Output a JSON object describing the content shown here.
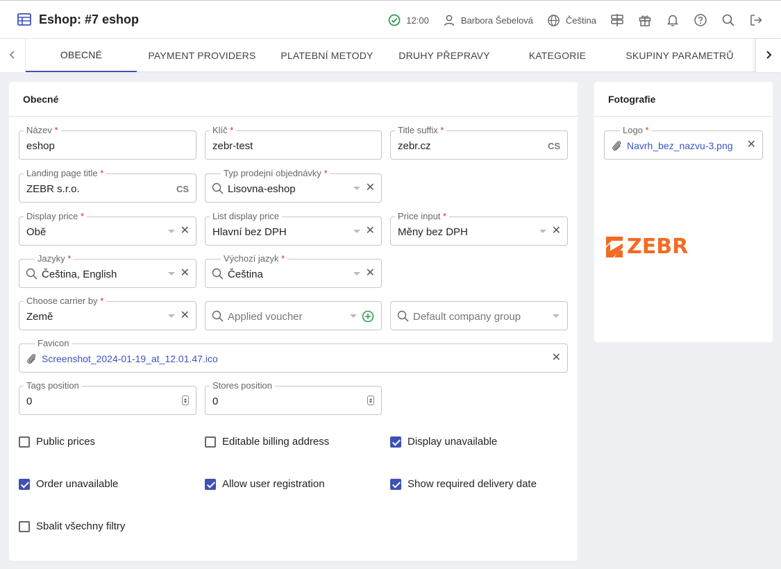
{
  "header": {
    "title": "Eshop: #7 eshop",
    "time": "12:00",
    "user": "Barbora Šebelová",
    "language": "Čeština"
  },
  "tabs": [
    {
      "label": "OBECNÉ",
      "active": true
    },
    {
      "label": "PAYMENT PROVIDERS"
    },
    {
      "label": "PLATEBNÍ METODY"
    },
    {
      "label": "DRUHY PŘEPRAVY"
    },
    {
      "label": "KATEGORIE"
    },
    {
      "label": "SKUPINY PARAMETRŮ"
    }
  ],
  "general": {
    "title": "Obecné",
    "fields": {
      "name": {
        "label": "Název",
        "value": "eshop"
      },
      "key": {
        "label": "Klíč",
        "value": "zebr-test"
      },
      "title_suffix": {
        "label": "Title suffix",
        "value": "zebr.cz",
        "lang": "CS"
      },
      "landing_title": {
        "label": "Landing page title",
        "value": "ZEBR s.r.o.",
        "lang": "CS"
      },
      "order_type": {
        "label": "Typ prodejní objednávky",
        "value": "Lisovna-eshop"
      },
      "display_price": {
        "label": "Display price",
        "value": "Obě"
      },
      "list_display_price": {
        "label": "List display price",
        "value": "Hlavní bez DPH"
      },
      "price_input": {
        "label": "Price input",
        "value": "Měny bez DPH"
      },
      "languages": {
        "label": "Jazyky",
        "value": "Čeština, English"
      },
      "default_language": {
        "label": "Výchozí jazyk",
        "value": "Čeština"
      },
      "carrier_by": {
        "label": "Choose carrier by",
        "value": "Země"
      },
      "voucher": {
        "placeholder": "Applied voucher"
      },
      "company_group": {
        "placeholder": "Default company group"
      },
      "favicon": {
        "label": "Favicon",
        "value": "Screenshot_2024-01-19_at_12.01.47.ico"
      },
      "tags_position": {
        "label": "Tags position",
        "value": "0"
      },
      "stores_position": {
        "label": "Stores position",
        "value": "0"
      }
    },
    "checkboxes": [
      {
        "label": "Public prices",
        "checked": false
      },
      {
        "label": "Editable billing address",
        "checked": false
      },
      {
        "label": "Display unavailable",
        "checked": true
      },
      {
        "label": "Order unavailable",
        "checked": true
      },
      {
        "label": "Allow user registration",
        "checked": true
      },
      {
        "label": "Show required delivery date",
        "checked": true
      },
      {
        "label": "Sbalit všechny filtry",
        "checked": false
      }
    ]
  },
  "photos": {
    "title": "Fotografie",
    "logo": {
      "label": "Logo",
      "value": "Navrh_bez_nazvu-3.png"
    },
    "logo_text": "ZEBR"
  },
  "colors": {
    "accent": "#3f51b5",
    "brand": "#f26b22",
    "required": "#d32f2f",
    "ok": "#2e9e4f"
  }
}
